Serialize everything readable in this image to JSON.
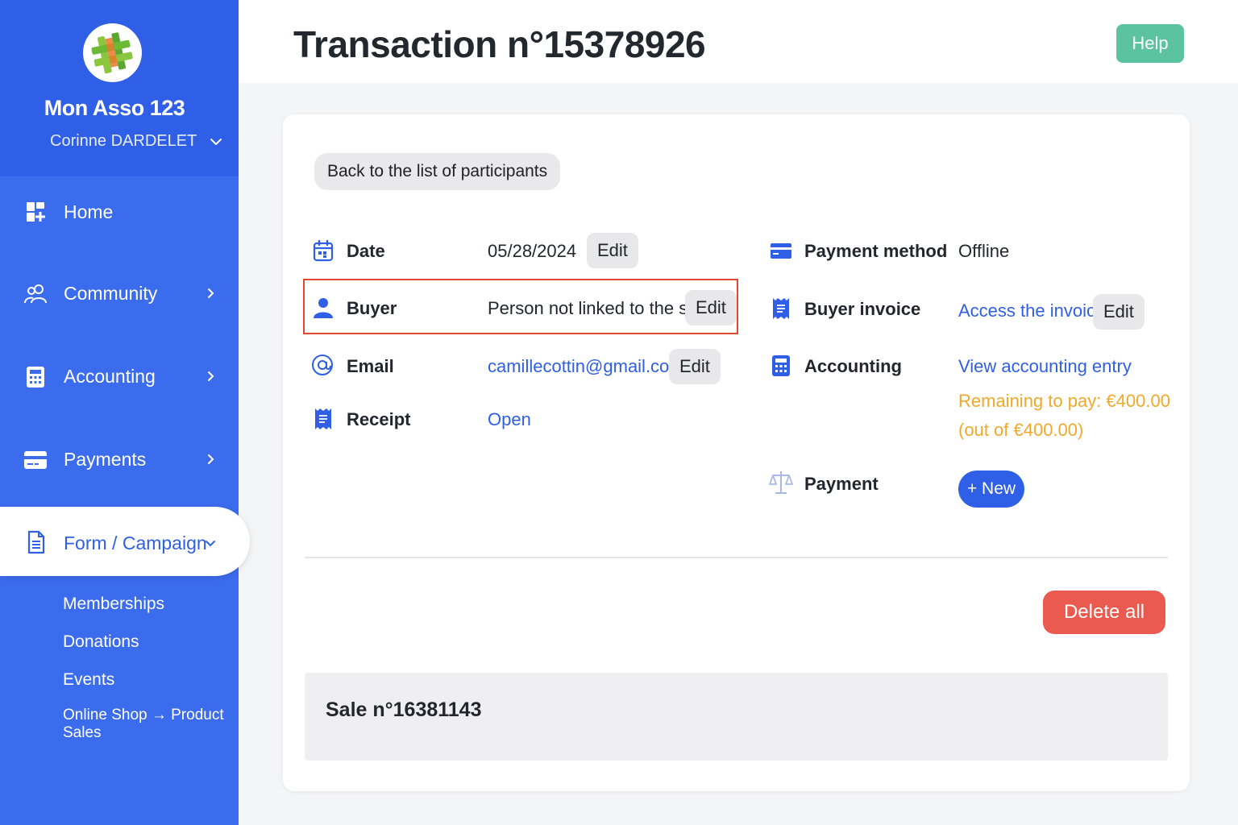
{
  "sidebar": {
    "org_name": "Mon Asso 123",
    "user_name": "Corinne DARDELET",
    "items": [
      {
        "label": "Home",
        "icon": "home-grid-icon"
      },
      {
        "label": "Community",
        "icon": "users-icon"
      },
      {
        "label": "Accounting",
        "icon": "calculator-icon"
      },
      {
        "label": "Payments",
        "icon": "credit-card-icon"
      },
      {
        "label": "Form / Campaign",
        "icon": "document-icon"
      }
    ],
    "subitems": [
      "Memberships",
      "Donations",
      "Events",
      "Online Shop → Product Sales"
    ]
  },
  "header": {
    "title": "Transaction n°15378926",
    "help_label": "Help"
  },
  "details": {
    "back_label": "Back to the list of participants",
    "edit_label": "Edit",
    "date": {
      "label": "Date",
      "value": "05/28/2024"
    },
    "buyer": {
      "label": "Buyer",
      "value": "Person not linked to the sale"
    },
    "email": {
      "label": "Email",
      "value": "camillecottin@gmail.com"
    },
    "receipt": {
      "label": "Receipt",
      "value": "Open"
    },
    "payment_method": {
      "label": "Payment method",
      "value": "Offline"
    },
    "buyer_invoice": {
      "label": "Buyer invoice",
      "value": "Access the invoice"
    },
    "accounting": {
      "label": "Accounting",
      "value": "View accounting entry",
      "remaining": "Remaining to pay: €400.00",
      "out_of": "(out of €400.00)"
    },
    "payment": {
      "label": "Payment",
      "new_label": "+ New"
    },
    "delete_label": "Delete all",
    "sale_title": "Sale n°16381143"
  },
  "colors": {
    "sidebar": "#3c6cee",
    "accent": "#2f5fe6",
    "help": "#5cc3a0",
    "delete": "#eb5a4f",
    "warning": "#f0a92a",
    "highlight": "#e5472d"
  }
}
